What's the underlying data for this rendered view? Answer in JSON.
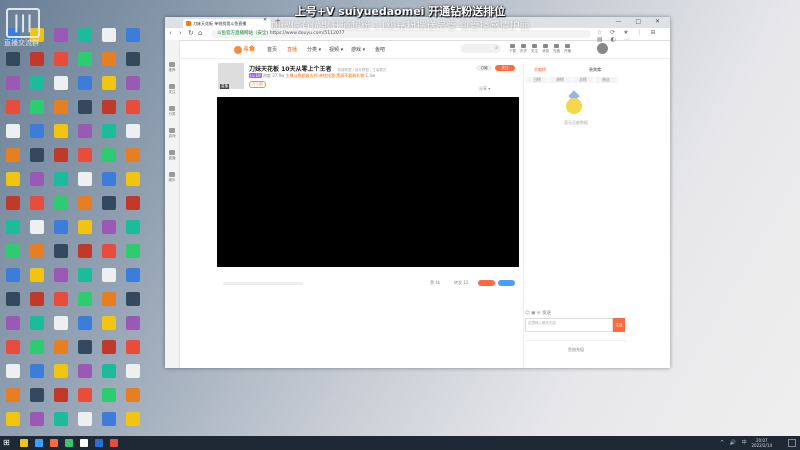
{
  "overlay": {
    "line1": "上号+V suiyuedaomei  开通钻粉送排位",
    "line2": "加微信有优惠开通超粉 11级钻粉摆送房管 包管播感情护丽"
  },
  "browser": {
    "tab_title": "刀妹天花板 单挑找我斗鱼直播",
    "url_prefix": "斗鱼官方直播网站（安全)",
    "url": "https://www.douyu.com/5112077",
    "window_controls": "— □ ✕",
    "toolbar_icons": "☆ ⟳ ★ ⋮ ⊞ ▤ ◐ ⋯"
  },
  "left_sidebar": {
    "items": [
      "推荐",
      "关注",
      "分类",
      "游戏",
      "直播",
      "娱乐"
    ]
  },
  "site_nav": {
    "logo": "斗鱼",
    "items": [
      "首页",
      "直播",
      "分类 ▾",
      "视频 ▾",
      "游戏 ▾",
      "鱼吧"
    ],
    "active_index": 1,
    "search_icon": "search-icon",
    "header_icons": [
      "下载",
      "历史",
      "关注",
      "消息",
      "充值",
      "开播"
    ]
  },
  "room": {
    "title": "刀妹天花板  10天从零上个王者",
    "category_path": "英雄联盟 / 娱乐联盟 / 王者模式",
    "level_badge": "Lv.18",
    "hot": "热度 37.9w",
    "notice": "主播斗鱼超级大师·单挑找我·黑屏不要刷礼物",
    "count": "1.4w",
    "live_badge": "直播",
    "tag": "万人团",
    "follow_label": "关注",
    "subscribe_label": "订阅",
    "share_label": "分享 ▾"
  },
  "video_bar": {
    "likes": "赞 4k",
    "shares": "转发 12"
  },
  "right_panel": {
    "tabs": [
      "贡献榜",
      "贵宾席"
    ],
    "rank_tabs": [
      "日榜",
      "周榜",
      "总榜",
      "粉丝"
    ],
    "mascot_caption": "暂无贡献数据",
    "chat_tools": "☺ ▣ ✉   发送",
    "chat_placeholder": "这里输入聊天内容",
    "send_label": "发送",
    "gift_area": "鱼翅充值"
  },
  "taskbar": {
    "clock_time": "20:07",
    "clock_date": "2022/2/14",
    "tray": "^ 🔊 中"
  },
  "desktop_logo_text": "直播交流群"
}
